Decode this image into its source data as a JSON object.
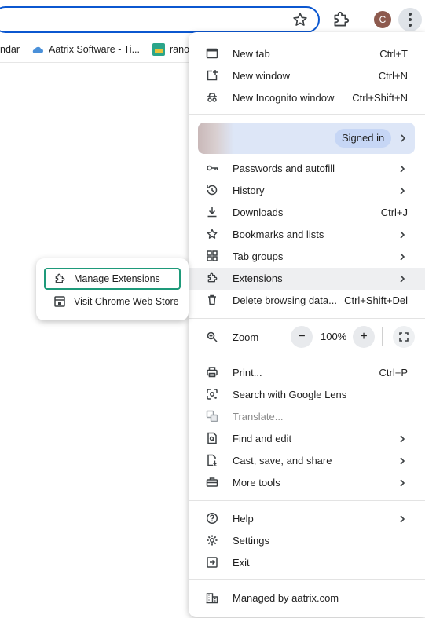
{
  "toolbar": {
    "avatar_letter": "C",
    "icons": [
      "star-icon",
      "extensions-icon",
      "kebab-menu-icon"
    ]
  },
  "bookmarks": [
    {
      "label": "ndar"
    },
    {
      "label": "Aatrix Software - Ti..."
    },
    {
      "label": "rano"
    }
  ],
  "menu": {
    "group1": [
      {
        "label": "New tab",
        "shortcut": "Ctrl+T"
      },
      {
        "label": "New window",
        "shortcut": "Ctrl+N"
      },
      {
        "label": "New Incognito window",
        "shortcut": "Ctrl+Shift+N"
      }
    ],
    "profile": {
      "signed_in": "Signed in"
    },
    "group2": [
      {
        "label": "Passwords and autofill"
      },
      {
        "label": "History"
      },
      {
        "label": "Downloads",
        "shortcut": "Ctrl+J"
      },
      {
        "label": "Bookmarks and lists"
      },
      {
        "label": "Tab groups"
      },
      {
        "label": "Extensions"
      },
      {
        "label": "Delete browsing data...",
        "shortcut": "Ctrl+Shift+Del"
      }
    ],
    "zoom": {
      "label": "Zoom",
      "minus": "−",
      "value": "100%",
      "plus": "+"
    },
    "group3": [
      {
        "label": "Print...",
        "shortcut": "Ctrl+P"
      },
      {
        "label": "Search with Google Lens"
      },
      {
        "label": "Translate..."
      },
      {
        "label": "Find and edit"
      },
      {
        "label": "Cast, save, and share"
      },
      {
        "label": "More tools"
      }
    ],
    "group4": [
      {
        "label": "Help"
      },
      {
        "label": "Settings"
      },
      {
        "label": "Exit"
      }
    ],
    "managed": {
      "label": "Managed by aatrix.com"
    }
  },
  "submenu": {
    "items": [
      {
        "label": "Manage Extensions"
      },
      {
        "label": "Visit Chrome Web Store"
      }
    ]
  },
  "colors": {
    "focus_ring": "#1e9a7a",
    "omnibox_border": "#0b57d0",
    "highlight": "#eeeff1",
    "profile_bg": "#dde6f7"
  }
}
